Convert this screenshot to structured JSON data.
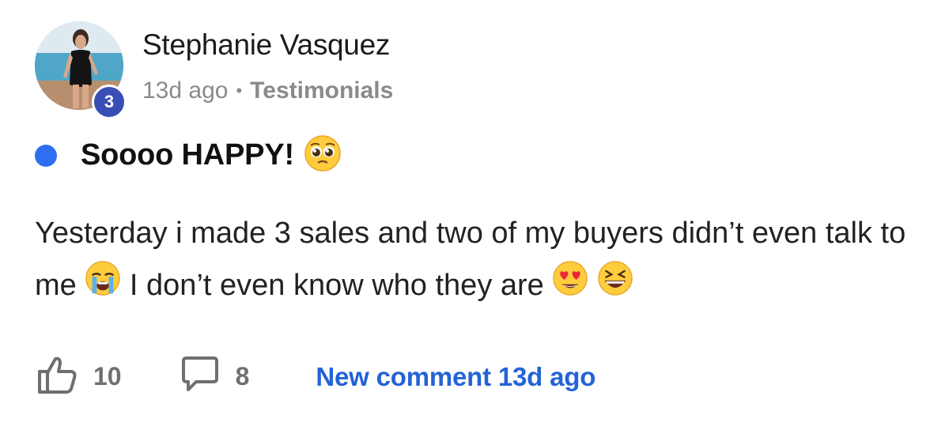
{
  "post": {
    "author": "Stephanie Vasquez",
    "level": "3",
    "time_ago": "13d ago",
    "separator": "•",
    "category": "Testimonials",
    "title": "Soooo HAPPY!",
    "body_part1": "Yesterday i made 3 sales and two of my buyers didn’t even talk to me",
    "body_part2": "I don’t even know who they are",
    "likes": "10",
    "comments": "8",
    "new_comment": "New comment 13d ago"
  },
  "colors": {
    "unread_dot": "#2d6ff0",
    "level_badge": "#3a4fb5",
    "link": "#2463d6",
    "muted": "#8a8a8a"
  },
  "icons": {
    "title_emoji": "pleading-face-emoji",
    "body_emoji_1": "loudly-crying-face-emoji",
    "body_emoji_2": "heart-eyes-emoji",
    "body_emoji_3": "squinting-laughing-emoji",
    "like": "thumbs-up-icon",
    "comment": "speech-bubble-icon"
  }
}
